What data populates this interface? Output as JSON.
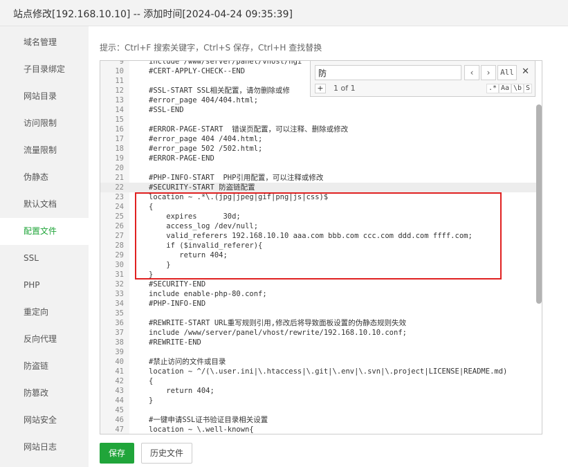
{
  "window": {
    "title": "站点修改[192.168.10.10] -- 添加时间[2024-04-24 09:35:39]"
  },
  "sidebar": {
    "items": [
      {
        "label": "域名管理",
        "active": false
      },
      {
        "label": "子目录绑定",
        "active": false
      },
      {
        "label": "网站目录",
        "active": false
      },
      {
        "label": "访问限制",
        "active": false
      },
      {
        "label": "流量限制",
        "active": false
      },
      {
        "label": "伪静态",
        "active": false
      },
      {
        "label": "默认文档",
        "active": false
      },
      {
        "label": "配置文件",
        "active": true
      },
      {
        "label": "SSL",
        "active": false
      },
      {
        "label": "PHP",
        "active": false
      },
      {
        "label": "重定向",
        "active": false
      },
      {
        "label": "反向代理",
        "active": false
      },
      {
        "label": "防盗链",
        "active": false
      },
      {
        "label": "防篡改",
        "active": false
      },
      {
        "label": "网站安全",
        "active": false
      },
      {
        "label": "网站日志",
        "active": false
      }
    ]
  },
  "hint": "提示：Ctrl+F 搜索关键字，Ctrl+S 保存，Ctrl+H 查找替换",
  "search": {
    "query": "防",
    "prev_icon": "‹",
    "next_icon": "›",
    "all_label": "All",
    "close_icon": "✕",
    "count": "1 of 1",
    "plus_label": "+",
    "opt_regex": ".*",
    "opt_case": "Aa",
    "opt_word": "\\b",
    "opt_sel": "S"
  },
  "editor": {
    "lines": [
      {
        "n": "9",
        "t": "include /www/server/panel/vhost/ngi"
      },
      {
        "n": "10",
        "t": "#CERT-APPLY-CHECK--END"
      },
      {
        "n": "11",
        "t": ""
      },
      {
        "n": "12",
        "t": "#SSL-START SSL相关配置，请勿删除或修"
      },
      {
        "n": "13",
        "t": "#error_page 404/404.html;"
      },
      {
        "n": "14",
        "t": "#SSL-END"
      },
      {
        "n": "15",
        "t": ""
      },
      {
        "n": "16",
        "t": "#ERROR-PAGE-START  错误页配置，可以注释、删除或修改"
      },
      {
        "n": "17",
        "t": "#error_page 404 /404.html;"
      },
      {
        "n": "18",
        "t": "#error_page 502 /502.html;"
      },
      {
        "n": "19",
        "t": "#ERROR-PAGE-END"
      },
      {
        "n": "20",
        "t": ""
      },
      {
        "n": "21",
        "t": "#PHP-INFO-START  PHP引用配置，可以注释或修改"
      },
      {
        "n": "22",
        "t": "#SECURITY-START 防盗链配置"
      },
      {
        "n": "23",
        "t": "location ~ .*\\.(jpg|jpeg|gif|png|js|css)$"
      },
      {
        "n": "24",
        "t": "{"
      },
      {
        "n": "25",
        "t": "    expires      30d;"
      },
      {
        "n": "26",
        "t": "    access_log /dev/null;"
      },
      {
        "n": "27",
        "t": "    valid_referers 192.168.10.10 aaa.com bbb.com ccc.com ddd.com ffff.com;"
      },
      {
        "n": "28",
        "t": "    if ($invalid_referer){"
      },
      {
        "n": "29",
        "t": "       return 404;"
      },
      {
        "n": "30",
        "t": "    }"
      },
      {
        "n": "31",
        "t": "}"
      },
      {
        "n": "32",
        "t": "#SECURITY-END"
      },
      {
        "n": "33",
        "t": "include enable-php-80.conf;"
      },
      {
        "n": "34",
        "t": "#PHP-INFO-END"
      },
      {
        "n": "35",
        "t": ""
      },
      {
        "n": "36",
        "t": "#REWRITE-START URL重写规则引用,修改后将导致面板设置的伪静态规则失效"
      },
      {
        "n": "37",
        "t": "include /www/server/panel/vhost/rewrite/192.168.10.10.conf;"
      },
      {
        "n": "38",
        "t": "#REWRITE-END"
      },
      {
        "n": "39",
        "t": ""
      },
      {
        "n": "40",
        "t": "#禁止访问的文件或目录"
      },
      {
        "n": "41",
        "t": "location ~ ^/(\\.user.ini|\\.htaccess|\\.git|\\.env|\\.svn|\\.project|LICENSE|README.md)"
      },
      {
        "n": "42",
        "t": "{"
      },
      {
        "n": "43",
        "t": "    return 404;"
      },
      {
        "n": "44",
        "t": "}"
      },
      {
        "n": "45",
        "t": ""
      },
      {
        "n": "46",
        "t": "#一键申请SSL证书验证目录相关设置"
      },
      {
        "n": "47",
        "t": "location ~ \\.well-known{"
      }
    ]
  },
  "buttons": {
    "save": "保存",
    "history": "历史文件"
  }
}
